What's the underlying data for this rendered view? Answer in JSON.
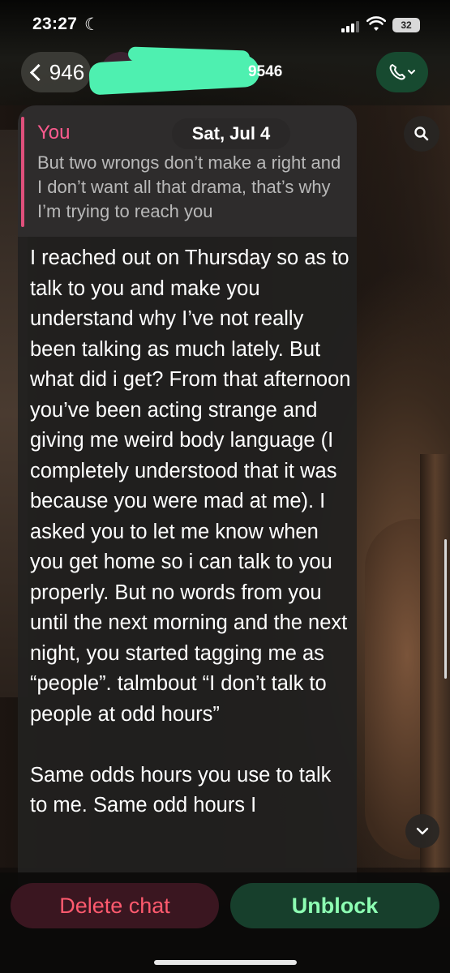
{
  "status_bar": {
    "time": "23:27",
    "battery": "32"
  },
  "header": {
    "back_count": "946",
    "contact_name": "9546",
    "call_icon": "phone-icon"
  },
  "reply": {
    "sender": "You",
    "date": "Sat, Jul 4",
    "quoted_text": "But two wrongs don’t make a right and I don’t want all that drama, that’s why I’m trying to reach you"
  },
  "message": {
    "text": "I reached out on Thursday so as to talk to you and make you understand why I’ve not really been talking as much lately. But what did i get? From that afternoon you’ve been acting strange and giving me weird body language (I completely understood that it was because you were mad at me). I asked you to let me know when you get home so i can talk to you properly. But no words from you until the next morning and the next night, you started tagging me as “people”. talmbout “I don’t talk to people at odd hours”\n\nSame odds hours you use to talk to me. Same odd hours I"
  },
  "actions": {
    "delete_label": "Delete chat",
    "unblock_label": "Unblock"
  },
  "colors": {
    "delete": "#ff5a6e",
    "unblock": "#8dffb3",
    "quote_accent": "#ff5b8f",
    "redaction": "#4ef0b0"
  }
}
